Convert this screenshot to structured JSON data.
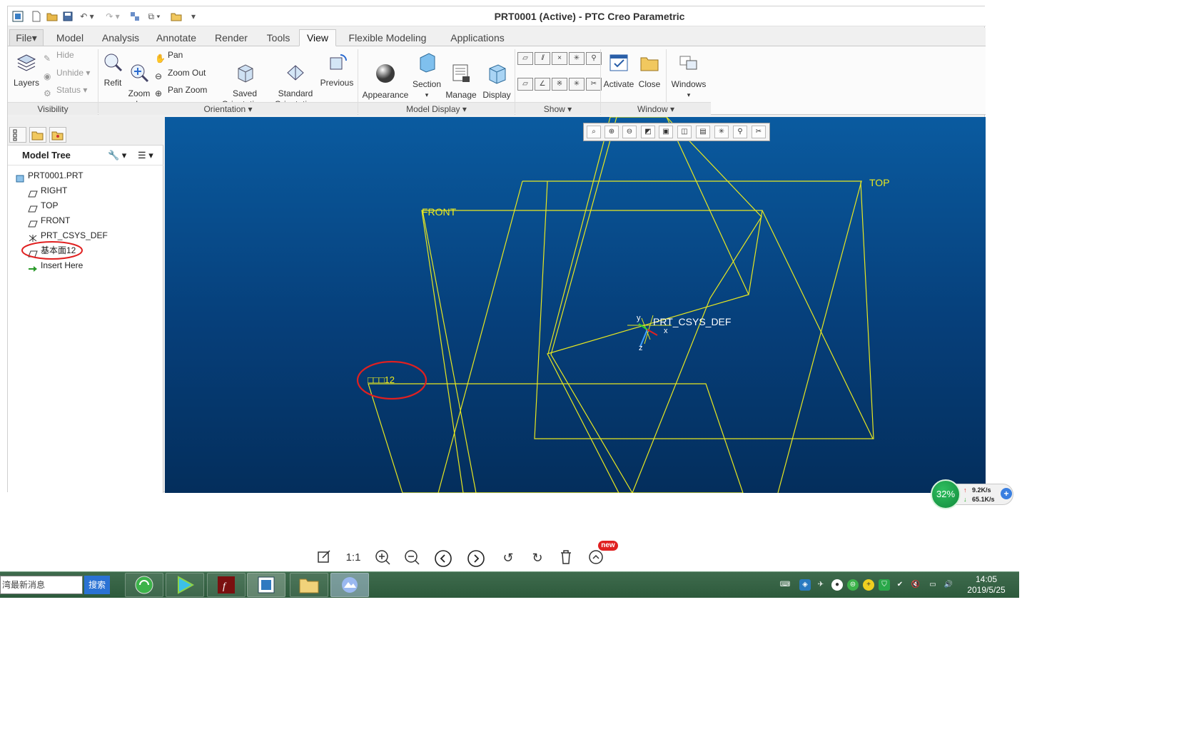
{
  "window": {
    "title": "PRT0001 (Active) - PTC Creo Parametric"
  },
  "tabs": [
    {
      "label": "File"
    },
    {
      "label": "Model"
    },
    {
      "label": "Analysis"
    },
    {
      "label": "Annotate"
    },
    {
      "label": "Render"
    },
    {
      "label": "Tools"
    },
    {
      "label": "View"
    },
    {
      "label": "Flexible Modeling"
    },
    {
      "label": "Applications"
    }
  ],
  "active_tab": "View",
  "ribbon": {
    "layers": "Layers",
    "hide": "Hide",
    "unhide": "Unhide",
    "status": "Status",
    "refit": "Refit",
    "zoom_in": "Zoom\nIn",
    "pan": "Pan",
    "zoom_out": "Zoom Out",
    "pan_zoom": "Pan Zoom",
    "saved_orientations": "Saved\nOrientations",
    "standard_orientation": "Standard\nOrientation",
    "previous": "Previous",
    "appearance_gallery": "Appearance\nGallery",
    "section": "Section",
    "manage_views": "Manage\nViews",
    "display_style": "Display\nStyle",
    "activate": "Activate",
    "close": "Close",
    "windows": "Windows",
    "groups": {
      "visibility": "Visibility",
      "orientation": "Orientation",
      "model_display": "Model Display",
      "show": "Show",
      "window": "Window"
    }
  },
  "model_tree": {
    "title": "Model Tree",
    "items": [
      {
        "label": "PRT0001.PRT"
      },
      {
        "label": "RIGHT"
      },
      {
        "label": "TOP"
      },
      {
        "label": "FRONT"
      },
      {
        "label": "PRT_CSYS_DEF"
      },
      {
        "label": "基本面12"
      },
      {
        "label": "Insert Here"
      }
    ]
  },
  "graphics": {
    "labels": {
      "top": "TOP",
      "front": "FRONT",
      "csys": "PRT_CSYS_DEF",
      "csys_y": "y",
      "csys_x": "x",
      "csys_z": "z",
      "plane12": "□□□12"
    },
    "plane_color": "#e8e820",
    "annotation_color": "#e02020"
  },
  "viewer": {
    "ratio": "1:1",
    "new_badge": "new"
  },
  "net_monitor": {
    "cpu": "32%",
    "up": "9.2K/s",
    "down": "65.1K/s"
  },
  "taskbar": {
    "search_text": "湾最新消息",
    "search_button": "搜索",
    "time": "14:05",
    "date": "2019/5/25"
  }
}
